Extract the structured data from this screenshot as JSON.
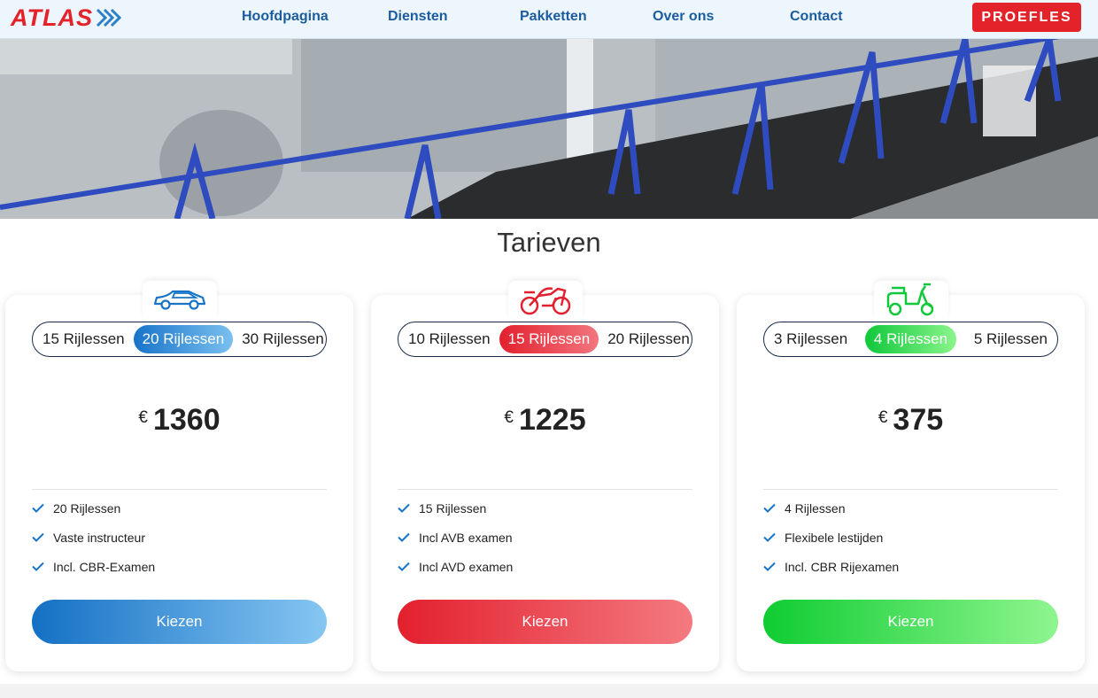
{
  "nav": {
    "logo_text": "ATLAS",
    "links": [
      "Hoofdpagina",
      "Diensten",
      "Pakketten",
      "Over ons",
      "Contact"
    ],
    "cta_label": "PROEFLES"
  },
  "hero": {
    "image": "bike-shelter-photo"
  },
  "pricing": {
    "title": "Tarieven",
    "cards": [
      {
        "icon": "car-icon",
        "accent": "#1874c9",
        "options": [
          "15 Rijlessen",
          "20 Rijlessen",
          "30 Rijlessen"
        ],
        "selected_index": 1,
        "currency": "€",
        "price": "1360",
        "features": [
          "20 Rijlessen",
          "Vaste instructeur",
          "Incl. CBR-Examen"
        ],
        "button_label": "Kiezen"
      },
      {
        "icon": "motorcycle-icon",
        "accent": "#e3202e",
        "options": [
          "10 Rijlessen",
          "15 Rijlessen",
          "20 Rijlessen"
        ],
        "selected_index": 1,
        "currency": "€",
        "price": "1225",
        "features": [
          "15 Rijlessen",
          "Incl AVB examen",
          "Incl AVD examen"
        ],
        "button_label": "Kiezen"
      },
      {
        "icon": "scooter-icon",
        "accent": "#10c83a",
        "options": [
          "3 Rijlessen",
          "4 Rijlessen",
          "5 Rijlessen"
        ],
        "selected_index": 1,
        "currency": "€",
        "price": "375",
        "features": [
          "4 Rijlessen",
          "Flexibele lestijden",
          "Incl. CBR Rijexamen"
        ],
        "button_label": "Kiezen"
      }
    ]
  }
}
